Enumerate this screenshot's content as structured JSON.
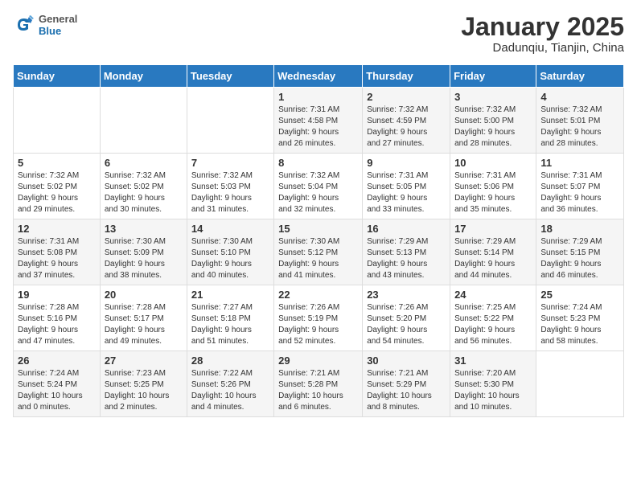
{
  "header": {
    "logo_general": "General",
    "logo_blue": "Blue",
    "month": "January 2025",
    "location": "Dadunqiu, Tianjin, China"
  },
  "weekdays": [
    "Sunday",
    "Monday",
    "Tuesday",
    "Wednesday",
    "Thursday",
    "Friday",
    "Saturday"
  ],
  "weeks": [
    [
      {
        "day": "",
        "info": ""
      },
      {
        "day": "",
        "info": ""
      },
      {
        "day": "",
        "info": ""
      },
      {
        "day": "1",
        "info": "Sunrise: 7:31 AM\nSunset: 4:58 PM\nDaylight: 9 hours\nand 26 minutes."
      },
      {
        "day": "2",
        "info": "Sunrise: 7:32 AM\nSunset: 4:59 PM\nDaylight: 9 hours\nand 27 minutes."
      },
      {
        "day": "3",
        "info": "Sunrise: 7:32 AM\nSunset: 5:00 PM\nDaylight: 9 hours\nand 28 minutes."
      },
      {
        "day": "4",
        "info": "Sunrise: 7:32 AM\nSunset: 5:01 PM\nDaylight: 9 hours\nand 28 minutes."
      }
    ],
    [
      {
        "day": "5",
        "info": "Sunrise: 7:32 AM\nSunset: 5:02 PM\nDaylight: 9 hours\nand 29 minutes."
      },
      {
        "day": "6",
        "info": "Sunrise: 7:32 AM\nSunset: 5:02 PM\nDaylight: 9 hours\nand 30 minutes."
      },
      {
        "day": "7",
        "info": "Sunrise: 7:32 AM\nSunset: 5:03 PM\nDaylight: 9 hours\nand 31 minutes."
      },
      {
        "day": "8",
        "info": "Sunrise: 7:32 AM\nSunset: 5:04 PM\nDaylight: 9 hours\nand 32 minutes."
      },
      {
        "day": "9",
        "info": "Sunrise: 7:31 AM\nSunset: 5:05 PM\nDaylight: 9 hours\nand 33 minutes."
      },
      {
        "day": "10",
        "info": "Sunrise: 7:31 AM\nSunset: 5:06 PM\nDaylight: 9 hours\nand 35 minutes."
      },
      {
        "day": "11",
        "info": "Sunrise: 7:31 AM\nSunset: 5:07 PM\nDaylight: 9 hours\nand 36 minutes."
      }
    ],
    [
      {
        "day": "12",
        "info": "Sunrise: 7:31 AM\nSunset: 5:08 PM\nDaylight: 9 hours\nand 37 minutes."
      },
      {
        "day": "13",
        "info": "Sunrise: 7:30 AM\nSunset: 5:09 PM\nDaylight: 9 hours\nand 38 minutes."
      },
      {
        "day": "14",
        "info": "Sunrise: 7:30 AM\nSunset: 5:10 PM\nDaylight: 9 hours\nand 40 minutes."
      },
      {
        "day": "15",
        "info": "Sunrise: 7:30 AM\nSunset: 5:12 PM\nDaylight: 9 hours\nand 41 minutes."
      },
      {
        "day": "16",
        "info": "Sunrise: 7:29 AM\nSunset: 5:13 PM\nDaylight: 9 hours\nand 43 minutes."
      },
      {
        "day": "17",
        "info": "Sunrise: 7:29 AM\nSunset: 5:14 PM\nDaylight: 9 hours\nand 44 minutes."
      },
      {
        "day": "18",
        "info": "Sunrise: 7:29 AM\nSunset: 5:15 PM\nDaylight: 9 hours\nand 46 minutes."
      }
    ],
    [
      {
        "day": "19",
        "info": "Sunrise: 7:28 AM\nSunset: 5:16 PM\nDaylight: 9 hours\nand 47 minutes."
      },
      {
        "day": "20",
        "info": "Sunrise: 7:28 AM\nSunset: 5:17 PM\nDaylight: 9 hours\nand 49 minutes."
      },
      {
        "day": "21",
        "info": "Sunrise: 7:27 AM\nSunset: 5:18 PM\nDaylight: 9 hours\nand 51 minutes."
      },
      {
        "day": "22",
        "info": "Sunrise: 7:26 AM\nSunset: 5:19 PM\nDaylight: 9 hours\nand 52 minutes."
      },
      {
        "day": "23",
        "info": "Sunrise: 7:26 AM\nSunset: 5:20 PM\nDaylight: 9 hours\nand 54 minutes."
      },
      {
        "day": "24",
        "info": "Sunrise: 7:25 AM\nSunset: 5:22 PM\nDaylight: 9 hours\nand 56 minutes."
      },
      {
        "day": "25",
        "info": "Sunrise: 7:24 AM\nSunset: 5:23 PM\nDaylight: 9 hours\nand 58 minutes."
      }
    ],
    [
      {
        "day": "26",
        "info": "Sunrise: 7:24 AM\nSunset: 5:24 PM\nDaylight: 10 hours\nand 0 minutes."
      },
      {
        "day": "27",
        "info": "Sunrise: 7:23 AM\nSunset: 5:25 PM\nDaylight: 10 hours\nand 2 minutes."
      },
      {
        "day": "28",
        "info": "Sunrise: 7:22 AM\nSunset: 5:26 PM\nDaylight: 10 hours\nand 4 minutes."
      },
      {
        "day": "29",
        "info": "Sunrise: 7:21 AM\nSunset: 5:28 PM\nDaylight: 10 hours\nand 6 minutes."
      },
      {
        "day": "30",
        "info": "Sunrise: 7:21 AM\nSunset: 5:29 PM\nDaylight: 10 hours\nand 8 minutes."
      },
      {
        "day": "31",
        "info": "Sunrise: 7:20 AM\nSunset: 5:30 PM\nDaylight: 10 hours\nand 10 minutes."
      },
      {
        "day": "",
        "info": ""
      }
    ]
  ]
}
